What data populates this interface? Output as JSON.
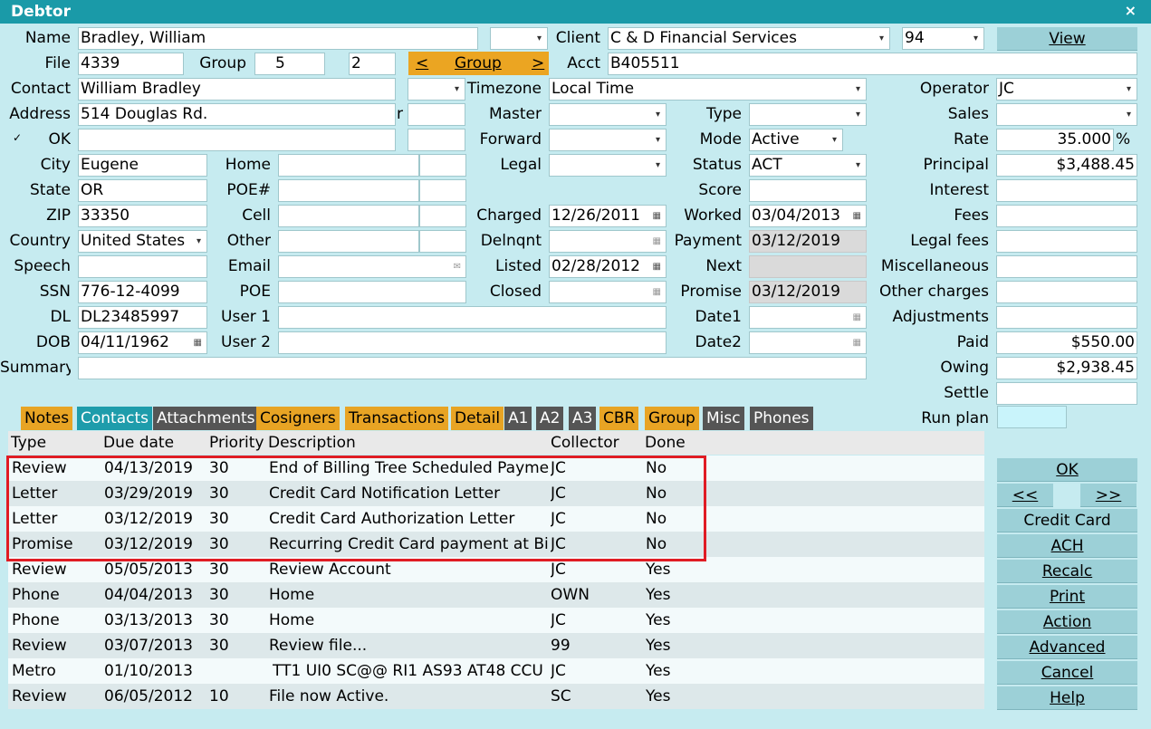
{
  "window": {
    "title": "Debtor",
    "close": "×"
  },
  "icons": {
    "dropdown": "▾",
    "calendar": "▦",
    "email": "✉",
    "check": "✓"
  },
  "labels": {
    "name": "Name",
    "file": "File",
    "group": "Group",
    "contact": "Contact",
    "address": "Address",
    "address_suffix": "r",
    "ok": "OK",
    "city": "City",
    "state": "State",
    "zip": "ZIP",
    "country": "Country",
    "speech": "Speech",
    "ssn": "SSN",
    "dl": "DL",
    "dob": "DOB",
    "summary": "Summary",
    "home": "Home",
    "poe_num": "POE#",
    "cell": "Cell",
    "other": "Other",
    "email": "Email",
    "poe": "POE",
    "user1": "User 1",
    "user2": "User 2",
    "client": "Client",
    "acct": "Acct",
    "timezone": "Timezone",
    "master": "Master",
    "forward": "Forward",
    "legal": "Legal",
    "charged": "Charged",
    "delnqnt": "Delnqnt",
    "listed": "Listed",
    "closed": "Closed",
    "type": "Type",
    "mode": "Mode",
    "status": "Status",
    "score": "Score",
    "worked": "Worked",
    "payment": "Payment",
    "next": "Next",
    "promise": "Promise",
    "date1": "Date1",
    "date2": "Date2",
    "operator": "Operator",
    "sales": "Sales",
    "rate": "Rate",
    "principal": "Principal",
    "interest": "Interest",
    "fees": "Fees",
    "legal_fees": "Legal fees",
    "misc": "Miscellaneous",
    "other_charges": "Other charges",
    "adjustments": "Adjustments",
    "paid": "Paid",
    "owing": "Owing",
    "settle": "Settle",
    "run_plan": "Run plan",
    "percent": "%"
  },
  "values": {
    "name": "Bradley, William",
    "file": "4339",
    "group": "5",
    "group2": "2",
    "contact": "William Bradley",
    "address": "514 Douglas Rd.",
    "city": "Eugene",
    "state": "OR",
    "zip": "33350",
    "country": "United States",
    "ssn": "776-12-4099",
    "dl": "DL23485997",
    "dob": "04/11/1962",
    "client": "C & D Financial Services",
    "client_num": "94",
    "acct": "B405511",
    "timezone": "Local Time",
    "charged": "12/26/2011",
    "listed": "02/28/2012",
    "mode": "Active",
    "status": "ACT",
    "worked": "03/04/2013",
    "payment": "03/12/2019",
    "promise": "03/12/2019",
    "operator": "JC",
    "rate": "35.000",
    "principal": "$3,488.45",
    "paid": "$550.00",
    "owing": "$2,938.45"
  },
  "group_nav": {
    "prev": "<",
    "label": "Group",
    "next": ">"
  },
  "buttons": {
    "view": "View",
    "ok": "OK",
    "prev": "<<",
    "next": ">>",
    "credit_card": "Credit Card",
    "ach": "ACH",
    "recalc": "Recalc",
    "print": "Print",
    "action": "Action",
    "advanced": "Advanced",
    "cancel": "Cancel",
    "help": "Help"
  },
  "tabs": [
    "Notes",
    "Contacts",
    "Attachments",
    "Cosigners",
    "Transactions",
    "Detail",
    "A1",
    "A2",
    "A3",
    "CBR",
    "Group",
    "Misc",
    "Phones"
  ],
  "table": {
    "headers": [
      "Type",
      "Due date",
      "Priority",
      "Description",
      "Collector",
      "Done"
    ],
    "rows": [
      [
        "Review",
        "04/13/2019",
        "30",
        "End of Billing Tree Scheduled Payments",
        "JC",
        "No"
      ],
      [
        "Letter",
        "03/29/2019",
        "30",
        "Credit Card Notification Letter",
        "JC",
        "No"
      ],
      [
        "Letter",
        "03/12/2019",
        "30",
        "Credit Card Authorization Letter",
        "JC",
        "No"
      ],
      [
        "Promise",
        "03/12/2019",
        "30",
        "Recurring Credit Card payment at Billing",
        "JC",
        "No"
      ],
      [
        "Review",
        "05/05/2013",
        "30",
        "Review Account",
        "JC",
        "Yes"
      ],
      [
        "Phone",
        "04/04/2013",
        "30",
        "Home",
        "OWN",
        "Yes"
      ],
      [
        "Phone",
        "03/13/2013",
        "30",
        "Home",
        "JC",
        "Yes"
      ],
      [
        "Review",
        "03/07/2013",
        "30",
        "Review file...",
        "99",
        "Yes"
      ],
      [
        "Metro",
        "01/10/2013",
        "",
        "TT1 UI0 SC@@ RI1 AS93 AT48 CCU",
        "JC",
        "Yes"
      ],
      [
        "Review",
        "06/05/2012",
        "10",
        "File now Active.",
        "SC",
        "Yes"
      ]
    ]
  }
}
